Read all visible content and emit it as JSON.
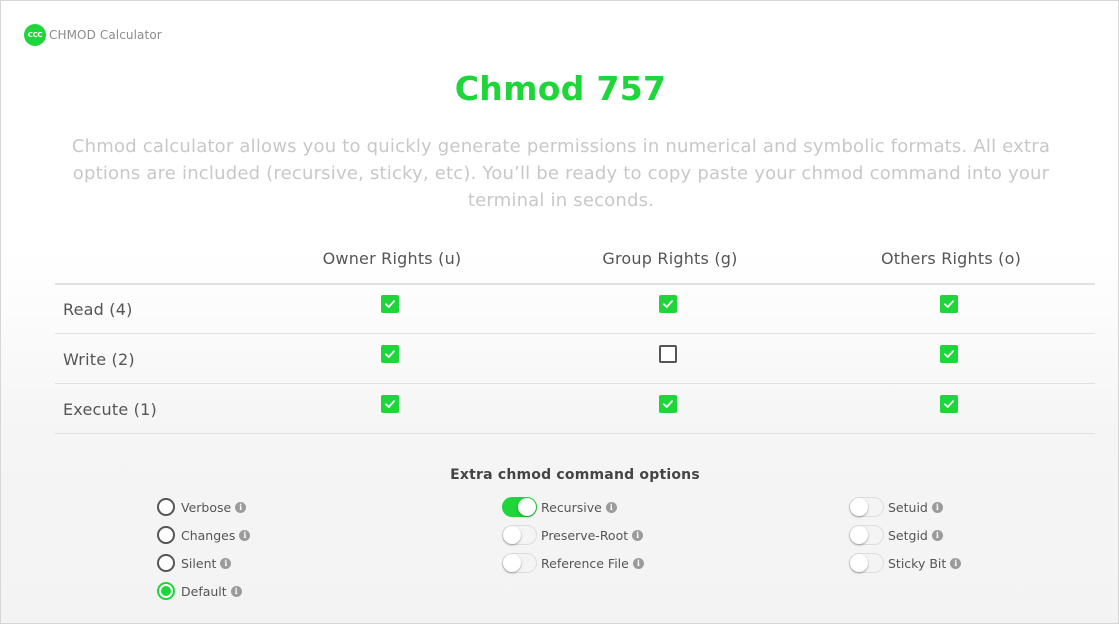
{
  "brand": {
    "logo_text": "CCC",
    "name": "CHMOD Calculator"
  },
  "page_title": "Chmod 757",
  "intro": "Chmod calculator allows you to quickly generate permissions in numerical and symbolic formats. All extra options are included (recursive, sticky, etc). You’ll be ready to copy paste your chmod command into your terminal in seconds.",
  "permissions": {
    "columns": [
      "Owner Rights (u)",
      "Group Rights (g)",
      "Others Rights (o)"
    ],
    "rows": [
      {
        "label": "Read (4)",
        "checked": [
          true,
          true,
          true
        ]
      },
      {
        "label": "Write (2)",
        "checked": [
          true,
          false,
          true
        ]
      },
      {
        "label": "Execute (1)",
        "checked": [
          true,
          true,
          true
        ]
      }
    ]
  },
  "options": {
    "title": "Extra chmod command options",
    "radios": [
      {
        "label": "Verbose",
        "selected": false
      },
      {
        "label": "Changes",
        "selected": false
      },
      {
        "label": "Silent",
        "selected": false
      },
      {
        "label": "Default",
        "selected": true
      }
    ],
    "toggles_middle": [
      {
        "label": "Recursive",
        "on": true
      },
      {
        "label": "Preserve-Root",
        "on": false
      },
      {
        "label": "Reference File",
        "on": false
      }
    ],
    "toggles_right": [
      {
        "label": "Setuid",
        "on": false
      },
      {
        "label": "Setgid",
        "on": false
      },
      {
        "label": "Sticky Bit",
        "on": false
      }
    ],
    "info_glyph": "i"
  },
  "colors": {
    "accent": "#1ed53a",
    "intro_text": "#c8c8c8",
    "muted": "#8c8c8c"
  }
}
